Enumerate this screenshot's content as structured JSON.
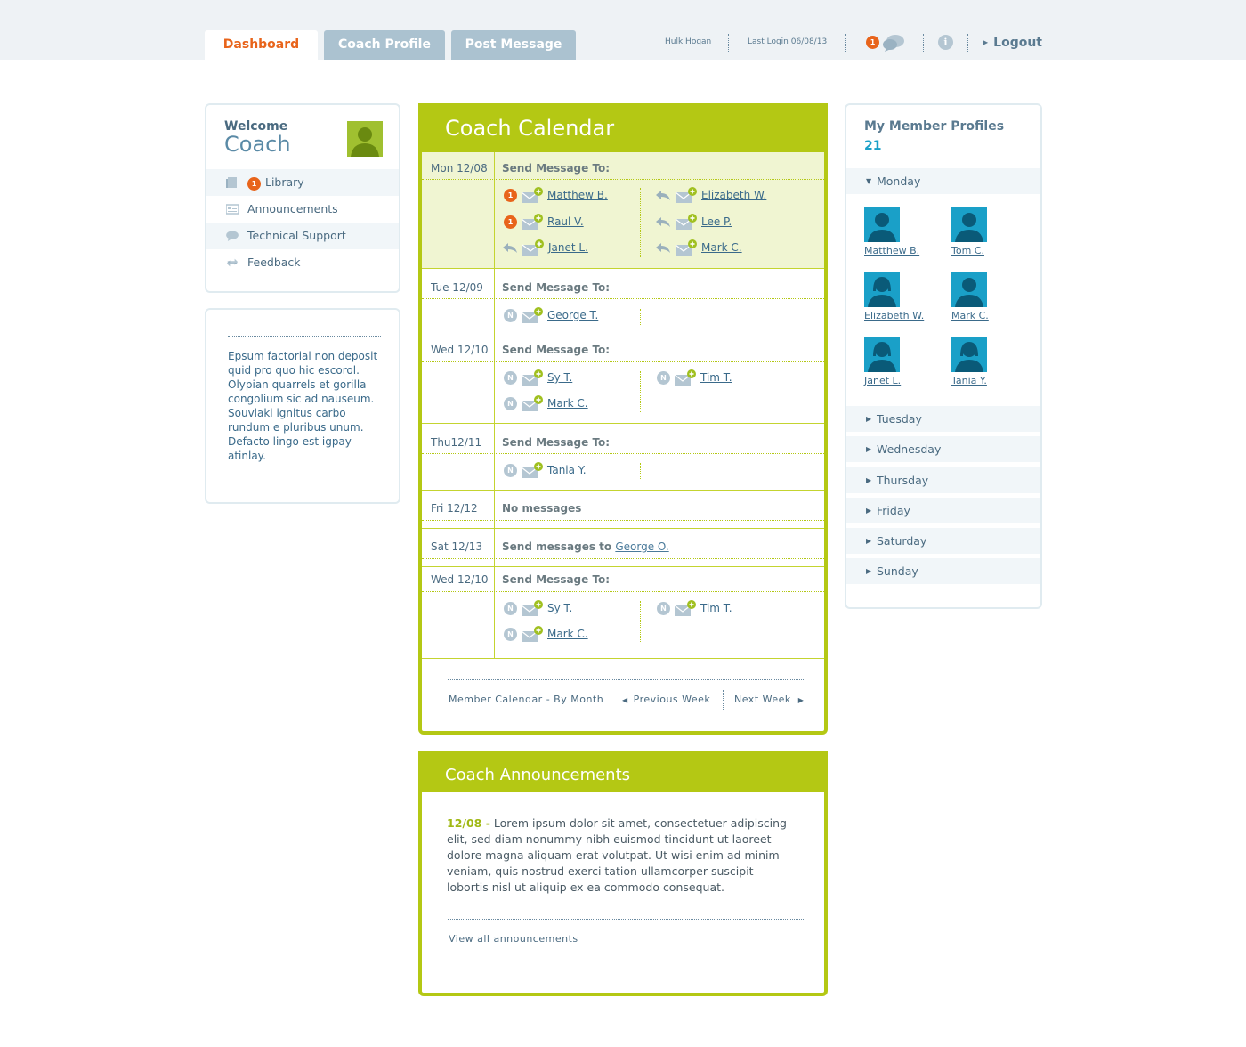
{
  "tabs": [
    {
      "label": "Dashboard",
      "active": true
    },
    {
      "label": "Coach Profile",
      "active": false
    },
    {
      "label": "Post Message",
      "active": false
    }
  ],
  "header": {
    "user_name": "Hulk Hogan",
    "last_login": "Last Login 06/08/13",
    "message_count": "1",
    "logout_label": "Logout"
  },
  "left": {
    "welcome": "Welcome",
    "coach": "Coach",
    "nav": [
      {
        "label": "Library",
        "icon": "book-icon",
        "badge": "1"
      },
      {
        "label": "Announcements",
        "icon": "newspaper-icon"
      },
      {
        "label": "Technical Support",
        "icon": "speech-bubble-icon"
      },
      {
        "label": "Feedback",
        "icon": "refresh-icon"
      }
    ],
    "text": "Epsum factorial non deposit quid pro quo hic escorol. Olypian quarrels et gorilla congolium sic ad nauseum. Souvlaki ignitus carbo rundum e pluribus unum. Defacto lingo est igpay atinlay."
  },
  "calendar": {
    "title": "Coach Calendar",
    "send_to": "Send Message To:",
    "days": [
      {
        "label": "Mon 12/08",
        "entries": [
          {
            "badge": "1",
            "name": "Matthew B."
          },
          {
            "badge": "1",
            "name": "Raul V."
          },
          {
            "badge": "reply",
            "name": "Janet L."
          },
          {
            "badge": "reply",
            "name": "Elizabeth W."
          },
          {
            "badge": "reply",
            "name": "Lee P."
          },
          {
            "badge": "reply",
            "name": "Mark C."
          }
        ]
      },
      {
        "label": "Tue 12/09",
        "entries": [
          {
            "badge": "N",
            "name": "George T."
          }
        ]
      },
      {
        "label": "Wed 12/10",
        "entries": [
          {
            "badge": "N",
            "name": "Sy T."
          },
          {
            "badge": "N",
            "name": "Mark C."
          },
          {
            "badge": "N",
            "name": "Tim T."
          }
        ]
      },
      {
        "label": "Thu12/11",
        "entries": [
          {
            "badge": "N",
            "name": "Tania Y."
          }
        ]
      },
      {
        "label": "Fri 12/12",
        "note": "No messages"
      },
      {
        "label": "Sat 12/13",
        "note": "Send messages to",
        "note_link": "George O."
      },
      {
        "label": "Wed 12/10",
        "entries": [
          {
            "badge": "N",
            "name": "Sy T."
          },
          {
            "badge": "N",
            "name": "Mark C."
          },
          {
            "badge": "N",
            "name": "Tim T."
          }
        ]
      }
    ],
    "footer": {
      "by_month": "Member Calendar - By Month",
      "prev": "Previous Week",
      "next": "Next Week"
    }
  },
  "announcements": {
    "title": "Coach Announcements",
    "date": "12/08 -",
    "text": "Lorem ipsum dolor sit amet, consectetuer adipiscing elit, sed diam nonummy nibh euismod tincidunt ut laoreet dolore magna aliquam erat volutpat. Ut wisi enim ad minim veniam, quis nostrud exerci tation ullamcorper suscipit lobortis nisl ut aliquip ex ea commodo consequat.",
    "view_all": "View all announcements"
  },
  "members": {
    "title": "My Member Profiles",
    "count": "21",
    "open_day": "Monday",
    "people": [
      {
        "name": "Matthew B.",
        "gender": "male"
      },
      {
        "name": "Tom C.",
        "gender": "male"
      },
      {
        "name": "Elizabeth W.",
        "gender": "female"
      },
      {
        "name": "Mark C.",
        "gender": "male"
      },
      {
        "name": "Janet L.",
        "gender": "female"
      },
      {
        "name": "Tania Y.",
        "gender": "female"
      }
    ],
    "days": [
      "Tuesday",
      "Wednesday",
      "Thursday",
      "Friday",
      "Saturday",
      "Sunday"
    ]
  },
  "colors": {
    "accent_green": "#b4c814",
    "accent_orange": "#e8641b",
    "accent_blue": "#1aa0c8",
    "tab_gray": "#abc2d0"
  }
}
